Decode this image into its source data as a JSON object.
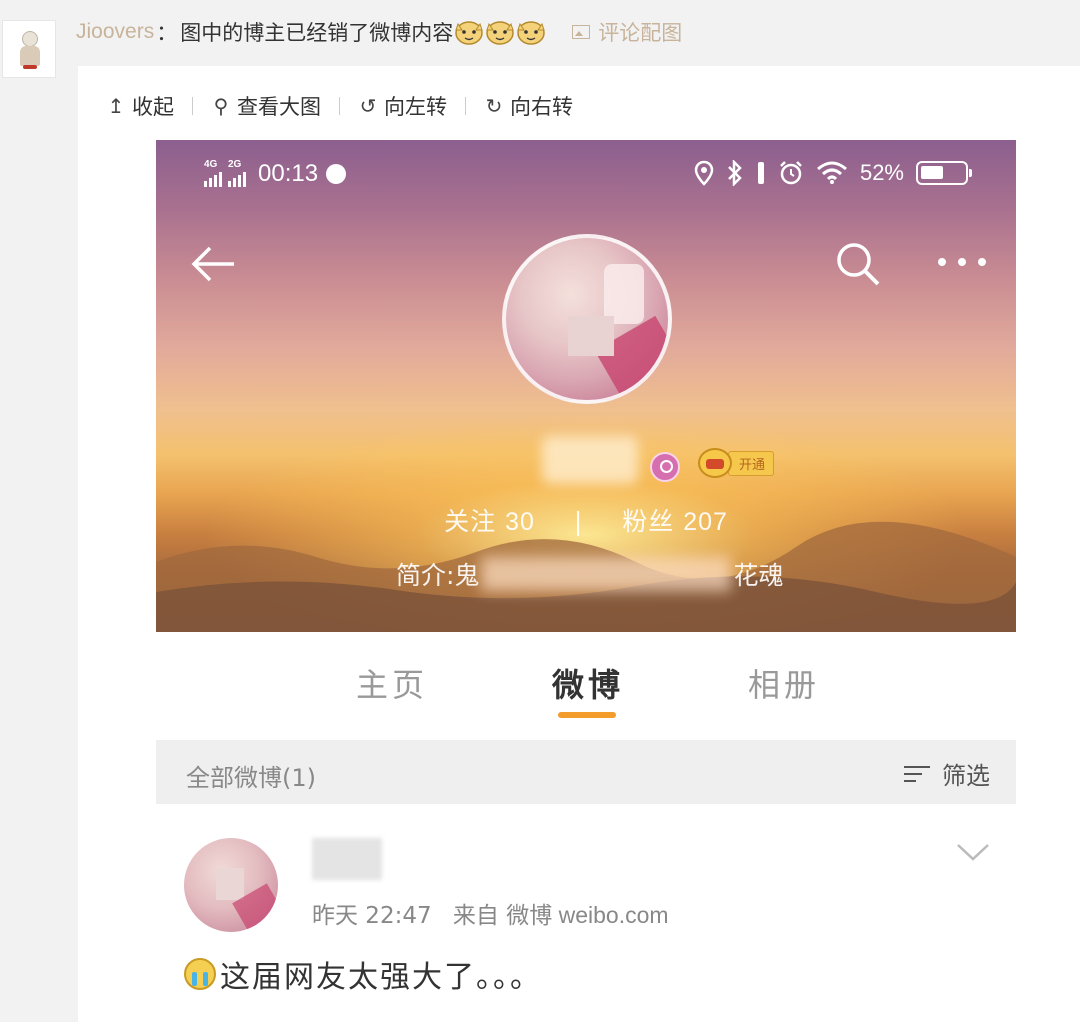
{
  "comment": {
    "username": "Jioovers",
    "colon": "：",
    "text": "图中的博主已经销了微博内容",
    "emoji_icon": "doge-emoji",
    "picture_link": "评论配图"
  },
  "toolbar": {
    "collapse": "收起",
    "view_large": "查看大图",
    "rotate_left": "向左转",
    "rotate_right": "向右转"
  },
  "screenshot": {
    "status": {
      "net1": "4G",
      "net2": "2G",
      "time": "00:13",
      "battery": "52%",
      "battery_level": 0.52
    },
    "profile": {
      "follow_label": "关注",
      "follow_count": "30",
      "fans_label": "粉丝",
      "fans_count": "207",
      "bio_prefix": "简介:鬼",
      "bio_suffix": "花魂",
      "badge_tag": "开通"
    },
    "tabs": [
      "主页",
      "微博",
      "相册"
    ],
    "active_tab": "微博",
    "filter_bar": {
      "all_posts": "全部微博(1)",
      "filter": "筛选"
    },
    "post": {
      "time": "昨天 22:47",
      "from": "来自",
      "source": "微博 weibo.com",
      "text": "这届网友太强大了。。。"
    }
  },
  "colors": {
    "link": "#c8b49a",
    "accent": "#f39b2b",
    "tab_inactive": "#999999"
  }
}
